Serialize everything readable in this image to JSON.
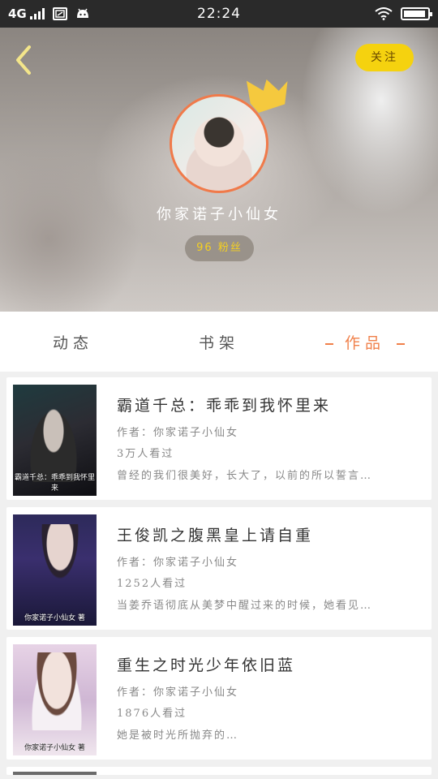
{
  "status_bar": {
    "network": "4G",
    "time": "22:24"
  },
  "header": {
    "follow_label": "关注",
    "username": "你家诺子小仙女",
    "fans": "96 粉丝"
  },
  "tabs": [
    {
      "label": "动态",
      "active": false
    },
    {
      "label": "书架",
      "active": false
    },
    {
      "label": "作品",
      "active": true
    }
  ],
  "works": [
    {
      "title": "霸道千总：乖乖到我怀里来",
      "author": "作者：你家诺子小仙女",
      "views": "3万人看过",
      "description": "曾经的我们很美好，长大了，以前的所以誓言…",
      "cover_caption": "霸道千总：乖乖到我怀里来"
    },
    {
      "title": "王俊凯之腹黑皇上请自重",
      "author": "作者：你家诺子小仙女",
      "views": "1252人看过",
      "description": "当姜乔语彻底从美梦中醒过来的时候，她看见…",
      "cover_caption": "你家诺子小仙女 著"
    },
    {
      "title": "重生之时光少年依旧蓝",
      "author": "作者：你家诺子小仙女",
      "views": "1876人看过",
      "description": "她是被时光所抛弃的…",
      "cover_caption": "你家诺子小仙女 著"
    }
  ],
  "colors": {
    "accent": "#f0804a",
    "follow_bg": "#f5d20f",
    "fans_text": "#f5d020"
  }
}
